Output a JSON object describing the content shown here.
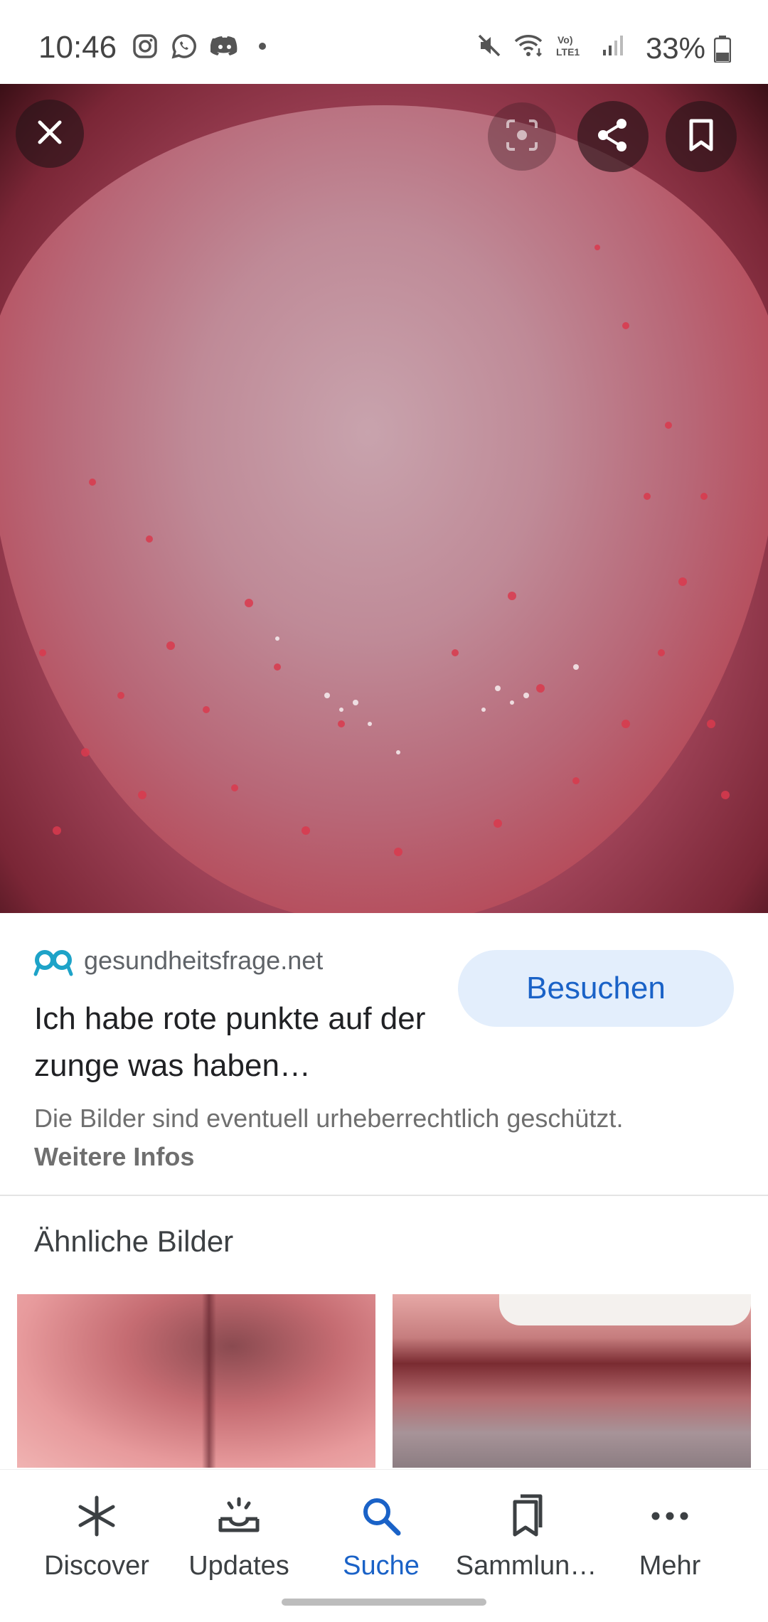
{
  "status_bar": {
    "time": "10:46",
    "battery_percent": "33%",
    "left_icons": [
      "instagram-icon",
      "whatsapp-icon",
      "discord-icon",
      "dot-icon"
    ],
    "right_icons": [
      "mute-icon",
      "wifi-icon",
      "volte-icon",
      "signal-icon",
      "battery-icon"
    ]
  },
  "image_viewer": {
    "toolbar_icons": [
      "close-icon",
      "lens-icon",
      "share-icon",
      "bookmark-icon"
    ]
  },
  "source": {
    "domain": "gesundheitsfrage.net",
    "title": "Ich habe rote punkte auf der zunge was haben…",
    "visit_label": "Besuchen",
    "copyright_notice": "Die Bilder sind eventuell urheberrechtlich geschützt.",
    "more_info_label": "Weitere Infos"
  },
  "similar": {
    "heading": "Ähnliche Bilder"
  },
  "bottom_nav": {
    "items": [
      {
        "label": "Discover",
        "icon": "asterisk-icon"
      },
      {
        "label": "Updates",
        "icon": "updates-icon"
      },
      {
        "label": "Suche",
        "icon": "search-icon"
      },
      {
        "label": "Sammlun…",
        "icon": "collections-icon"
      },
      {
        "label": "Mehr",
        "icon": "more-icon"
      }
    ],
    "active": "Suche"
  },
  "colors": {
    "accent": "#1a62c7",
    "visit_button_bg": "#e3eefc"
  }
}
